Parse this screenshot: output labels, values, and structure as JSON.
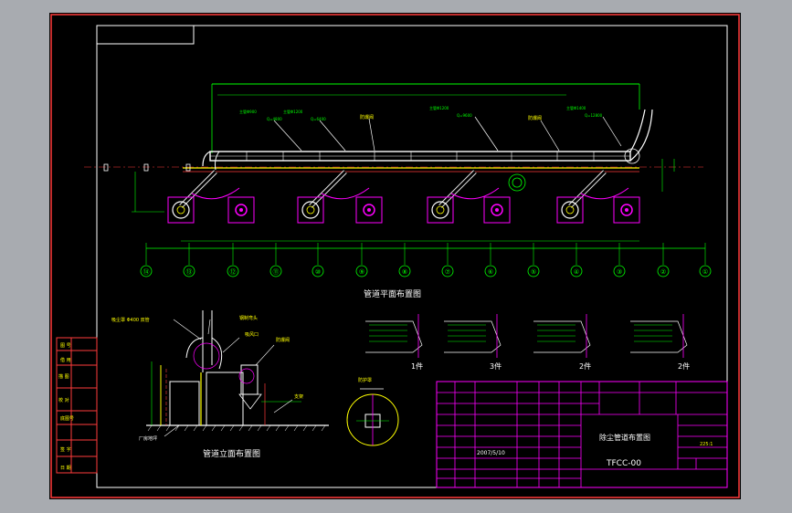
{
  "drawing": {
    "plan_title": "管道平面布置图",
    "elevation_title": "管道立面布置图",
    "axis_numbers": [
      "⑭",
      "⑬",
      "⑫",
      "⑪",
      "⑩",
      "⑨",
      "⑧",
      "⑦",
      "⑥",
      "⑤",
      "④",
      "③",
      "②",
      "①"
    ],
    "detail_counts": [
      "1件",
      "3件",
      "2件",
      "2件"
    ],
    "floor_label": "厂房地坪"
  },
  "title_block": {
    "drawing_name": "除尘管道布置图",
    "drawing_code": "TFCC-00",
    "date": "2007/5/10",
    "scale": "225:1"
  },
  "colors": {
    "background": "#000000",
    "frame": "#ff3b3b",
    "dimension": "#00ff00",
    "duct": "#ffffff",
    "magenta": "#ff00ff",
    "yellow": "#ffff00",
    "cyan": "#00ffff"
  }
}
